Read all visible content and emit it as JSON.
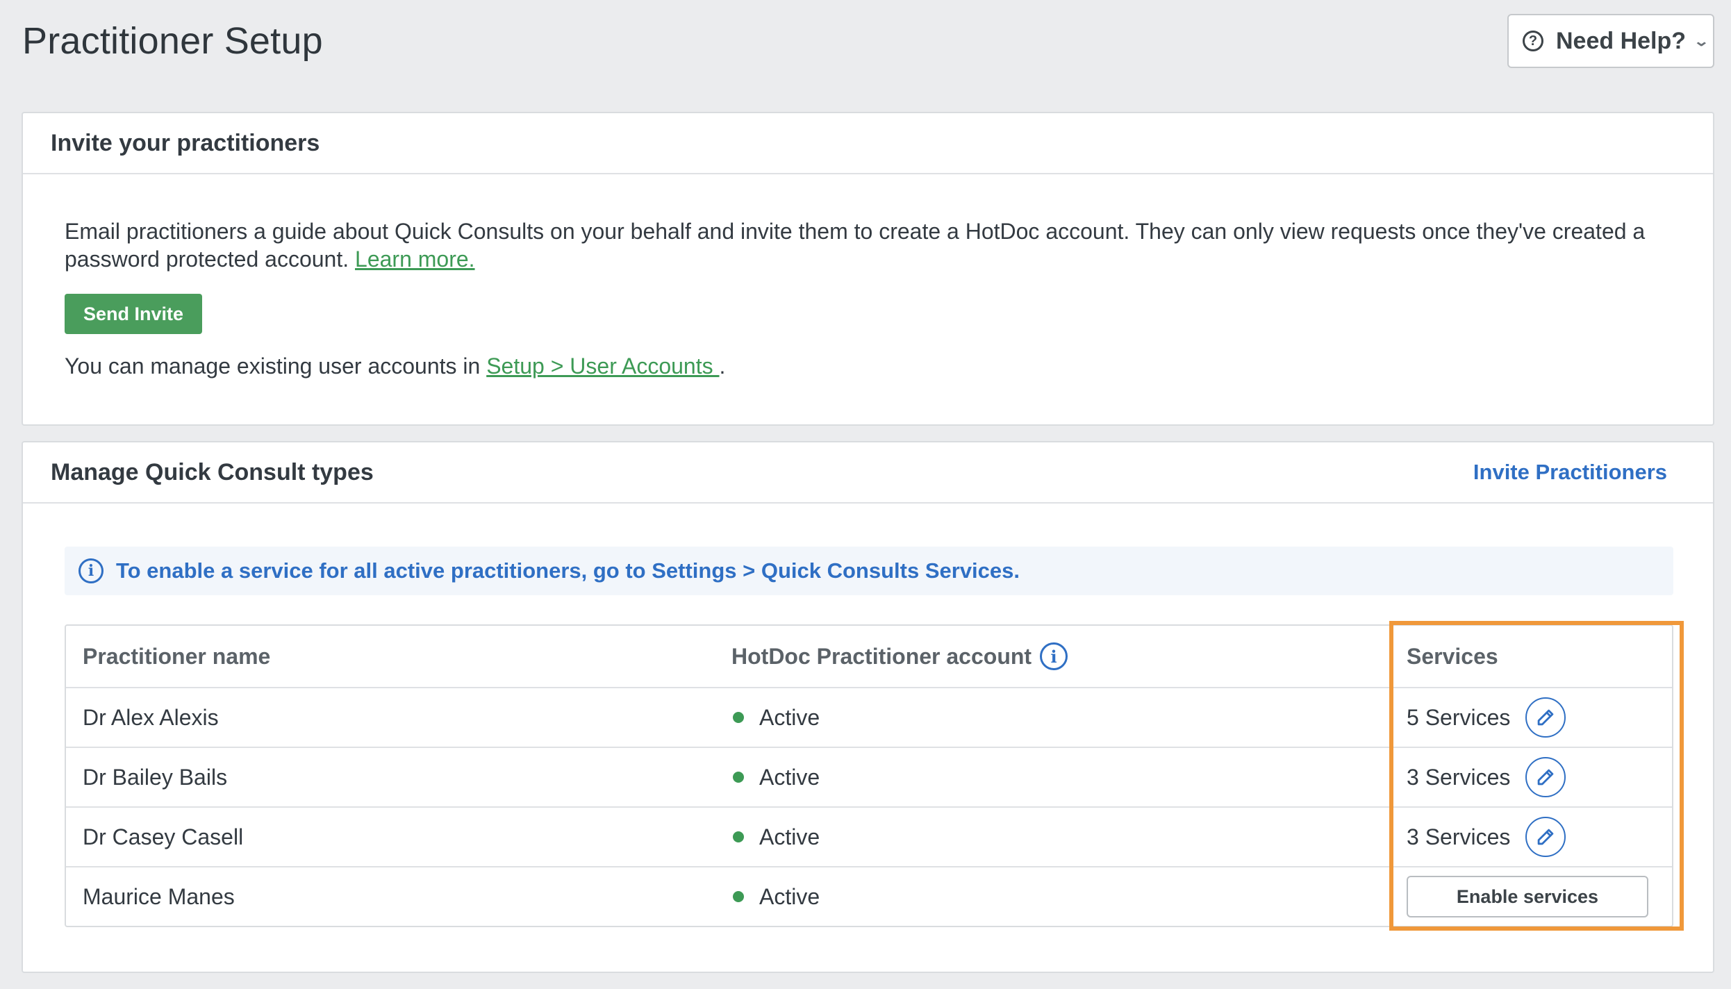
{
  "page": {
    "title": "Practitioner Setup"
  },
  "help": {
    "label": "Need Help?",
    "icon": "question-circle-icon"
  },
  "invite_card": {
    "title": "Invite your practitioners",
    "description": "Email practitioners a guide about Quick Consults on your behalf and invite them to create a HotDoc account. They can only view requests once they've created a password protected account.",
    "learn_more": "Learn more.",
    "send_invite": "Send Invite",
    "manage_prefix": "You can manage existing user accounts in",
    "manage_link": "Setup > User Accounts ",
    "manage_suffix": "."
  },
  "consult_card": {
    "title": "Manage Quick Consult types",
    "invite_link": "Invite Practitioners",
    "banner": "To enable a service for all active practitioners, go to Settings > Quick Consults Services.",
    "columns": [
      "Practitioner name",
      "HotDoc Practitioner account",
      "Services"
    ],
    "rows": [
      {
        "name": "Dr Alex Alexis",
        "status": "Active",
        "services": "5 Services"
      },
      {
        "name": "Dr Bailey Bails",
        "status": "Active",
        "services": "3 Services"
      },
      {
        "name": "Dr Casey Casell",
        "status": "Active",
        "services": "3 Services"
      },
      {
        "name": "Maurice Manes",
        "status": "Active",
        "enable_label": "Enable services"
      }
    ]
  },
  "colors": {
    "accent_green": "#4a9d5c",
    "link_blue": "#2f6fc4",
    "status_active": "#3d9a55",
    "highlight_orange": "#f0983a"
  }
}
